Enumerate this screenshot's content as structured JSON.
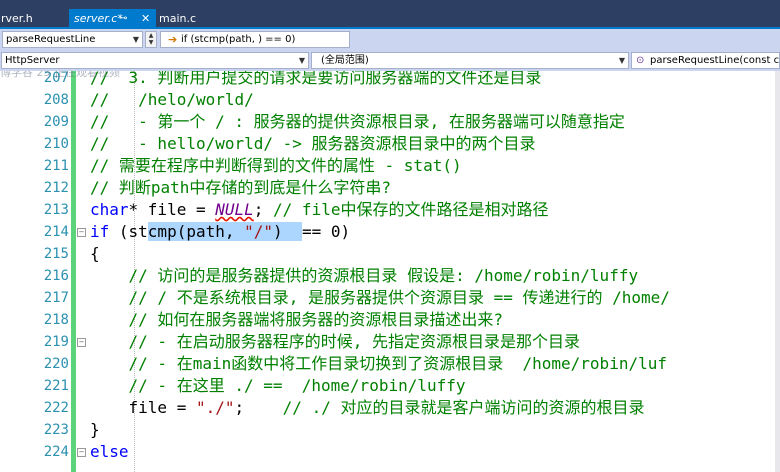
{
  "tabs": [
    {
      "label": "rver.h"
    },
    {
      "label": "server.c*",
      "pin": "⊸",
      "close": "✕"
    },
    {
      "label": "main.c"
    }
  ],
  "nav": {
    "function_combo": "parseRequestLine",
    "condition_label": "if (stcmp(path, ) == 0)",
    "project_combo": "HttpServer",
    "scope_combo": "(全局范围)",
    "member_combo": "parseRequestLine(const c",
    "ghost_text": "博学谷 25 正在观看视频"
  },
  "lines": [
    {
      "num": "207",
      "parts": [
        {
          "t": "//  3. 判断用户提交的请求是要访问服务器端的文件还是目录",
          "c": "cmt"
        }
      ]
    },
    {
      "num": "208",
      "parts": [
        {
          "t": "//   /helo/world/",
          "c": "cmt"
        }
      ]
    },
    {
      "num": "209",
      "parts": [
        {
          "t": "//   - 第一个 / : 服务器的提供资源根目录, 在服务器端可以随意指定",
          "c": "cmt"
        }
      ]
    },
    {
      "num": "210",
      "parts": [
        {
          "t": "//   - hello/world/ -> 服务器资源根目录中的两个目录",
          "c": "cmt"
        }
      ]
    },
    {
      "num": "211",
      "parts": [
        {
          "t": "// 需要在程序中判断得到的文件的属性 - stat()",
          "c": "cmt"
        }
      ]
    },
    {
      "num": "212",
      "parts": [
        {
          "t": "// 判断path中存储的到底是什么字符串?",
          "c": "cmt"
        }
      ]
    },
    {
      "num": "213",
      "parts": [
        {
          "t": "char",
          "c": "kw"
        },
        {
          "t": "* file = ",
          "c": ""
        },
        {
          "t": "NULL",
          "c": "nul"
        },
        {
          "t": "; ",
          "c": ""
        },
        {
          "t": "// file中保存的文件路径是相对路径",
          "c": "cmt"
        }
      ]
    },
    {
      "num": "214",
      "fold": "−",
      "parts": [
        {
          "t": "if",
          "c": "kw"
        },
        {
          "t": " (st",
          "c": ""
        },
        {
          "t": "cmp(path, ",
          "c": "sel"
        },
        {
          "t": "\"/\"",
          "c": "str sel"
        },
        {
          "t": ")  ",
          "c": "sel"
        },
        {
          "t": "== 0)",
          "c": ""
        }
      ]
    },
    {
      "num": "215",
      "parts": [
        {
          "t": "{",
          "c": ""
        }
      ]
    },
    {
      "num": "216",
      "parts": [
        {
          "t": "    // 访问的是服务器提供的资源根目录 假设是: /home/robin/luffy",
          "c": "cmt"
        }
      ]
    },
    {
      "num": "217",
      "parts": [
        {
          "t": "    // / 不是系统根目录, 是服务器提供个资源目录 == 传递进行的 /home/",
          "c": "cmt"
        }
      ]
    },
    {
      "num": "218",
      "parts": [
        {
          "t": "    // 如何在服务器端将服务器的资源根目录描述出来?",
          "c": "cmt"
        }
      ]
    },
    {
      "num": "219",
      "fold": "−",
      "parts": [
        {
          "t": "    // - 在启动服务器程序的时候, 先指定资源根目录是那个目录",
          "c": "cmt"
        }
      ]
    },
    {
      "num": "220",
      "parts": [
        {
          "t": "    // - 在main函数中将工作目录切换到了资源根目录  /home/robin/luf",
          "c": "cmt"
        }
      ]
    },
    {
      "num": "221",
      "parts": [
        {
          "t": "    // - 在这里 ./ ==  /home/robin/luffy",
          "c": "cmt"
        }
      ]
    },
    {
      "num": "222",
      "parts": [
        {
          "t": "    file = ",
          "c": ""
        },
        {
          "t": "\"./\"",
          "c": "str"
        },
        {
          "t": ";    ",
          "c": ""
        },
        {
          "t": "// ./ 对应的目录就是客户端访问的资源的根目录",
          "c": "cmt"
        }
      ]
    },
    {
      "num": "223",
      "parts": [
        {
          "t": "}",
          "c": ""
        }
      ]
    },
    {
      "num": "224",
      "fold": "−",
      "parts": [
        {
          "t": "else",
          "c": "kw"
        }
      ]
    }
  ]
}
